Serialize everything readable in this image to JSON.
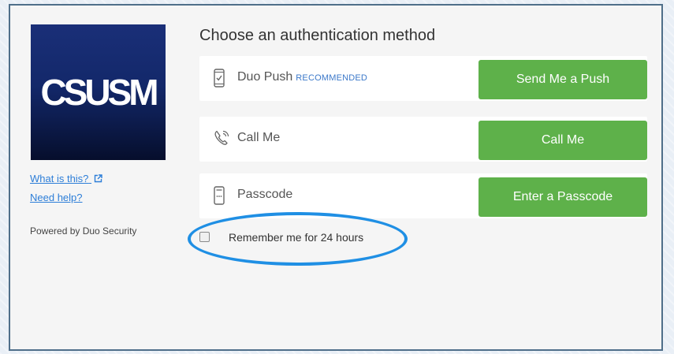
{
  "logo": {
    "text": "CSUSM"
  },
  "sidebar": {
    "what_is_this": "What is this?",
    "need_help": "Need help?",
    "powered_by": "Powered by Duo Security"
  },
  "main": {
    "heading": "Choose an authentication method",
    "methods": [
      {
        "label": "Duo Push",
        "badge": "RECOMMENDED",
        "icon": "phone-check-icon",
        "button": "Send Me a Push"
      },
      {
        "label": "Call Me",
        "icon": "phone-call-icon",
        "button": "Call Me"
      },
      {
        "label": "Passcode",
        "icon": "passcode-device-icon",
        "button": "Enter a Passcode"
      }
    ],
    "remember": {
      "label": "Remember me for 24 hours",
      "checked": false
    }
  },
  "colors": {
    "button_green": "#5eb14a",
    "link_blue": "#2d7ed8",
    "highlight_blue": "#1f8fe4",
    "logo_navy": "#13286a"
  }
}
